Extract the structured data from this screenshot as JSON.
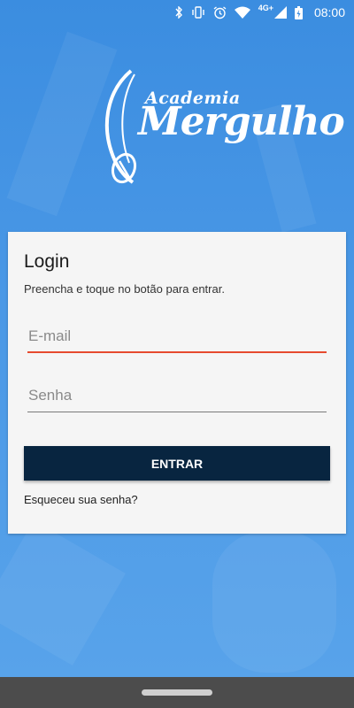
{
  "status_bar": {
    "time": "08:00",
    "network_label": "4G+"
  },
  "logo": {
    "line1": "Academia",
    "line2": "Mergulho"
  },
  "login_card": {
    "title": "Login",
    "subtitle": "Preencha e toque no botão para entrar.",
    "email_placeholder": "E-mail",
    "password_placeholder": "Senha",
    "submit_label": "ENTRAR",
    "forgot_label": "Esqueceu sua senha?"
  },
  "colors": {
    "background": "#3d8fe0",
    "card": "#f5f5f5",
    "button": "#082540",
    "email_underline": "#e64a2e"
  }
}
